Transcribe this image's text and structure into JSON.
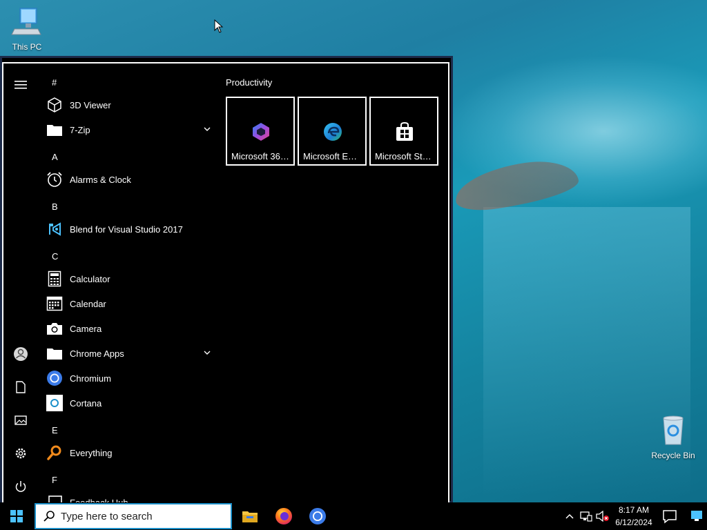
{
  "desktop": {
    "icons": [
      {
        "label": "This PC",
        "icon": "computer-icon"
      },
      {
        "label": "Recycle Bin",
        "icon": "recycle-bin-icon"
      }
    ]
  },
  "start_menu": {
    "rail": [
      "hamburger-icon",
      "user-icon",
      "documents-icon",
      "pictures-icon",
      "settings-icon",
      "power-icon"
    ],
    "app_list": [
      {
        "type": "letter",
        "text": "#"
      },
      {
        "type": "app",
        "label": "3D Viewer",
        "icon": "cube-icon"
      },
      {
        "type": "folder",
        "label": "7-Zip",
        "icon": "folder-icon"
      },
      {
        "type": "letter",
        "text": "A"
      },
      {
        "type": "app",
        "label": "Alarms & Clock",
        "icon": "alarm-clock-icon"
      },
      {
        "type": "letter",
        "text": "B"
      },
      {
        "type": "app",
        "label": "Blend for Visual Studio 2017",
        "icon": "blend-icon"
      },
      {
        "type": "letter",
        "text": "C"
      },
      {
        "type": "app",
        "label": "Calculator",
        "icon": "calculator-icon"
      },
      {
        "type": "app",
        "label": "Calendar",
        "icon": "calendar-icon"
      },
      {
        "type": "app",
        "label": "Camera",
        "icon": "camera-icon"
      },
      {
        "type": "folder",
        "label": "Chrome Apps",
        "icon": "folder-icon"
      },
      {
        "type": "app",
        "label": "Chromium",
        "icon": "chromium-icon"
      },
      {
        "type": "app",
        "label": "Cortana",
        "icon": "cortana-icon"
      },
      {
        "type": "letter",
        "text": "E"
      },
      {
        "type": "app",
        "label": "Everything",
        "icon": "search-magnifier-icon"
      },
      {
        "type": "letter",
        "text": "F"
      },
      {
        "type": "app",
        "label": "Feedback Hub",
        "icon": "feedback-icon"
      }
    ],
    "tiles_group": "Productivity",
    "tiles": [
      {
        "label": "Microsoft 365...",
        "icon": "microsoft-365-icon"
      },
      {
        "label": "Microsoft Edge",
        "icon": "edge-icon"
      },
      {
        "label": "Microsoft Store",
        "icon": "store-icon"
      }
    ]
  },
  "taskbar": {
    "search_placeholder": "Type here to search",
    "pinned": [
      "file-explorer-icon",
      "firefox-icon",
      "chromium-icon"
    ],
    "clock_time": "8:17 AM",
    "clock_date": "6/12/2024"
  },
  "colors": {
    "accent": "#1a8fc9",
    "menu_bg": "#000000"
  }
}
